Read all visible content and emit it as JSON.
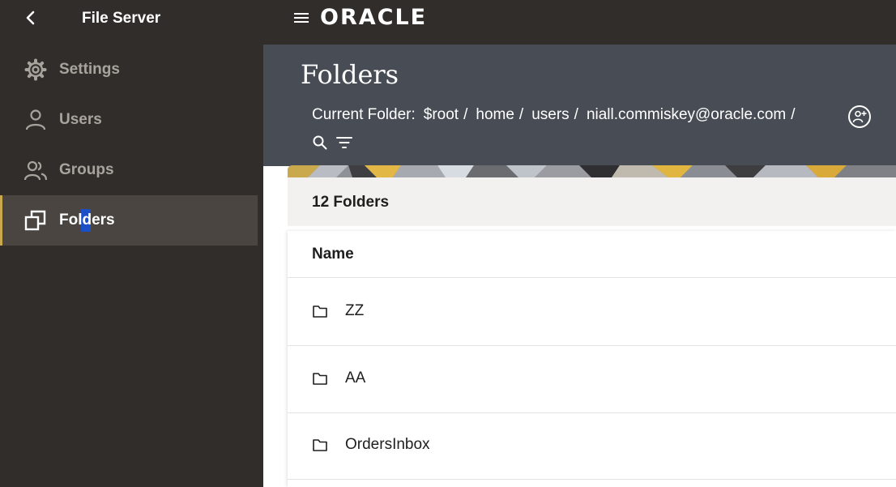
{
  "topbar": {
    "back_icon": "chevron-left-icon",
    "app_title": "File Server",
    "menu_icon": "hamburger-menu-icon",
    "logo_text": "ORACLE"
  },
  "sidebar": {
    "items": [
      {
        "label": "Settings",
        "icon": "gear-icon",
        "active": false
      },
      {
        "label": "Users",
        "icon": "user-icon",
        "active": false
      },
      {
        "label": "Groups",
        "icon": "users-group-icon",
        "active": false
      },
      {
        "label": "Folders",
        "icon": "folders-icon",
        "active": true
      }
    ]
  },
  "header": {
    "title": "Folders",
    "current_folder_label": "Current Folder:",
    "breadcrumb": [
      "$root",
      "home",
      "users",
      "niall.commiskey@oracle.com"
    ],
    "separator": "/"
  },
  "toolbar": {
    "share_icon": "manage-access-icon",
    "search_icon": "search-icon",
    "filter_icon": "filter-icon"
  },
  "content": {
    "count_label": "12 Folders",
    "column_header": "Name",
    "rows": [
      {
        "name": "ZZ"
      },
      {
        "name": "AA"
      },
      {
        "name": "OrdersInbox"
      }
    ]
  },
  "colors": {
    "topbar_bg": "#312d2a",
    "sidebar_active_bg": "#4a4541",
    "active_accent": "#c9a94b",
    "header_bg": "#474c55",
    "card_head_bg": "#f2f1ef"
  }
}
